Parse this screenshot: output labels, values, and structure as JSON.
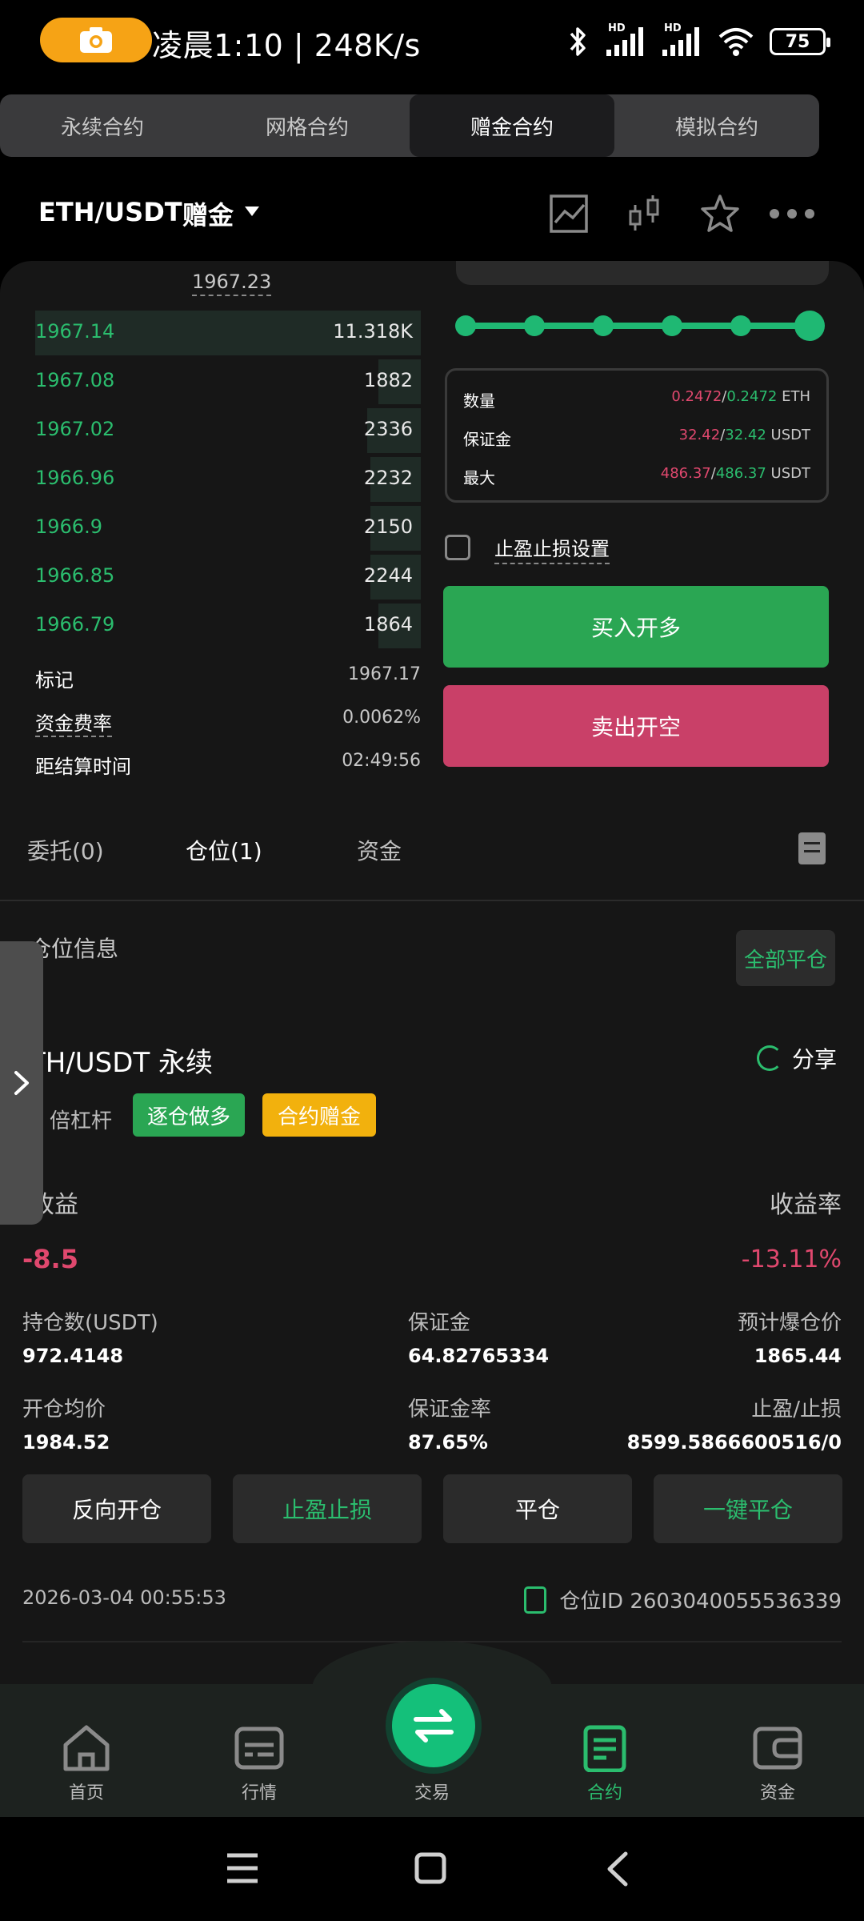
{
  "status_bar": {
    "text": "凌晨1:10 | 248K/s",
    "hd1": "HD",
    "hd2": "HD",
    "battery": "75"
  },
  "contract_tabs": [
    "永续合约",
    "网格合约",
    "赠金合约",
    "模拟合约"
  ],
  "pair": {
    "name": "ETH/USDT",
    "mode": "赠金"
  },
  "order_book": {
    "reference_price": "1967.23",
    "rows": [
      {
        "price": "1967.14",
        "qty": "11.318K",
        "depth": 1.0
      },
      {
        "price": "1967.08",
        "qty": "1882",
        "depth": 0.11
      },
      {
        "price": "1967.02",
        "qty": "2336",
        "depth": 0.14
      },
      {
        "price": "1966.96",
        "qty": "2232",
        "depth": 0.13
      },
      {
        "price": "1966.9",
        "qty": "2150",
        "depth": 0.13
      },
      {
        "price": "1966.85",
        "qty": "2244",
        "depth": 0.13
      },
      {
        "price": "1966.79",
        "qty": "1864",
        "depth": 0.11
      }
    ],
    "mark_label": "标记",
    "mark_value": "1967.17",
    "funding_label": "资金费率",
    "funding_value": "0.0062%",
    "settle_label": "距结算时间",
    "settle_value": "02:49:56"
  },
  "order_form": {
    "slider_percent": 100,
    "qty_label": "数量",
    "qty_a": "0.2472",
    "qty_b": "0.2472",
    "qty_unit": "ETH",
    "margin_label": "保证金",
    "margin_a": "32.42",
    "margin_b": "32.42",
    "margin_unit": "USDT",
    "max_label": "最大",
    "max_a": "486.37",
    "max_b": "486.37",
    "max_unit": "USDT",
    "tp_sl_label": "止盈止损设置",
    "buy_label": "买入开多",
    "sell_label": "卖出开空"
  },
  "sub_tabs": {
    "orders": "委托(0)",
    "positions": "仓位(1)",
    "funds": "资金"
  },
  "position": {
    "section_title": "仓位信息",
    "close_all": "全部平仓",
    "name": "TH/USDT 永续",
    "share": "分享",
    "leverage": "倍杠杆",
    "tag_long": "逐仓做多",
    "tag_bonus": "合约赠金",
    "pnl_label": "收益",
    "pnl_value": "-8.5",
    "roi_label": "收益率",
    "roi_value": "-13.11%",
    "holding_label": "持仓数(USDT)",
    "holding_value": "972.4148",
    "margin_label": "保证金",
    "margin_value": "64.82765334",
    "liq_label": "预计爆仓价",
    "liq_value": "1865.44",
    "entry_label": "开仓均价",
    "entry_value": "1984.52",
    "margin_rate_label": "保证金率",
    "margin_rate_value": "87.65%",
    "tpsl_label": "止盈/止损",
    "tpsl_value": "8599.5866600516/0",
    "btn_reverse": "反向开仓",
    "btn_tpsl": "止盈止损",
    "btn_close": "平仓",
    "btn_quick_close": "一键平仓",
    "date": "2026-03-04 00:55:53",
    "position_id": "仓位ID 2603040055536339"
  },
  "bottom_nav": {
    "home": "首页",
    "market": "行情",
    "trade": "交易",
    "contract": "合约",
    "assets": "资金"
  },
  "colors": {
    "green": "#2bbd6e",
    "red": "#e0486e",
    "accent_yellow": "#f2b10d",
    "buy_button": "#2aa653",
    "sell_button": "#c94068"
  }
}
